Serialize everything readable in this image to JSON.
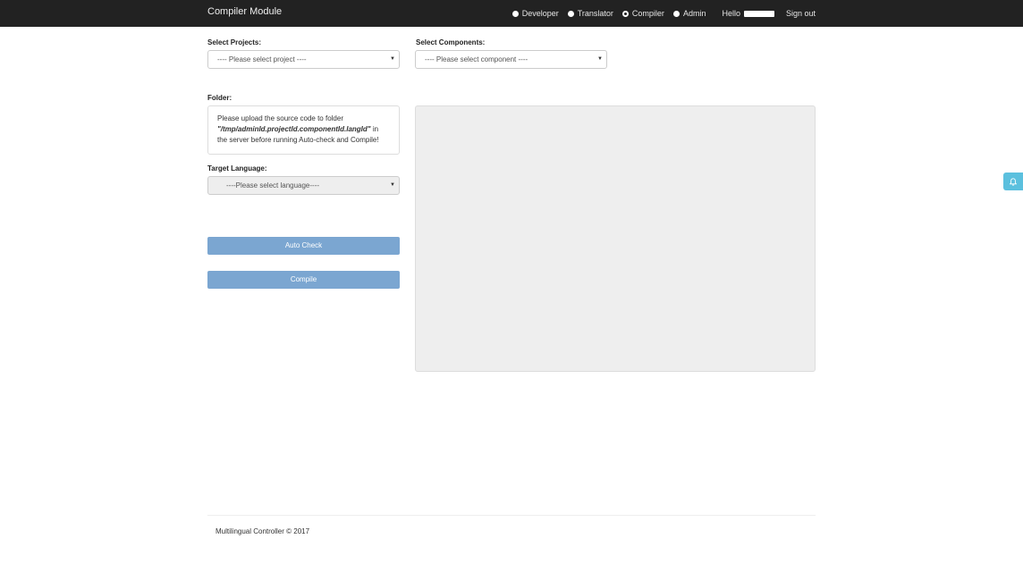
{
  "navbar": {
    "brand": "Compiler Module",
    "roles": [
      {
        "label": "Developer",
        "checked": false
      },
      {
        "label": "Translator",
        "checked": false
      },
      {
        "label": "Compiler",
        "checked": true
      },
      {
        "label": "Admin",
        "checked": false
      }
    ],
    "hello_label": "Hello",
    "signout_label": "Sign out"
  },
  "form": {
    "projects_label": "Select Projects:",
    "projects_value": "---- Please select project ----",
    "components_label": "Select Components:",
    "components_value": "---- Please select component ----",
    "folder_label": "Folder:",
    "folder_text_1": "Please upload the source code to folder",
    "folder_path": "\"/tmp/adminId.projectId.componentId.langId\"",
    "folder_text_2": " in",
    "folder_text_3": "the server before running Auto-check and Compile!",
    "language_label": "Target Language:",
    "language_value": "----Please select language----",
    "autocheck_label": "Auto Check",
    "compile_label": "Compile"
  },
  "footer": {
    "text": "Multilingual Controller © 2017"
  },
  "colors": {
    "navbar_bg": "#222222",
    "button_bg": "#7ba6d1",
    "notify_bg": "#5bc0de"
  },
  "icons": {
    "notify": "bell-icon",
    "select_caret": "caret-down-icon"
  }
}
